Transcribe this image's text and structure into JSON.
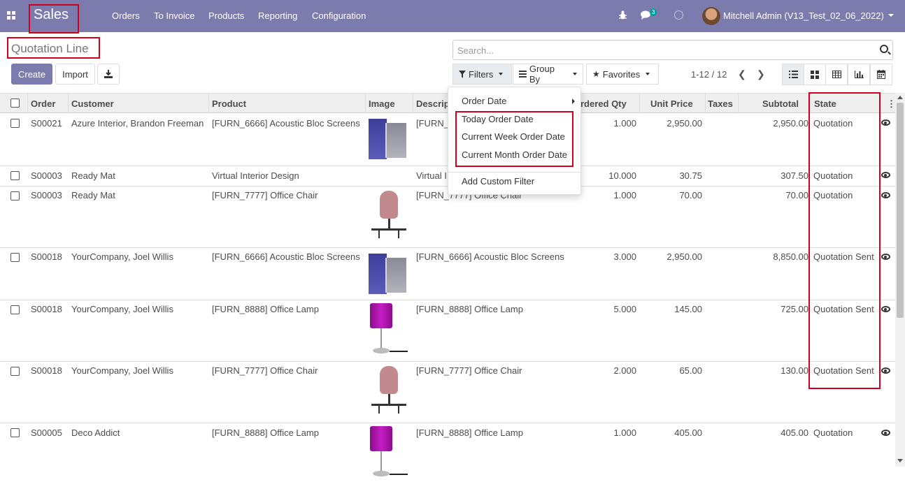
{
  "topbar": {
    "brand": "Sales",
    "menu": [
      "Orders",
      "To Invoice",
      "Products",
      "Reporting",
      "Configuration"
    ],
    "messages_count": "3",
    "user": "Mitchell Admin (V13_Test_02_06_2022)"
  },
  "page": {
    "title": "Quotation Line",
    "search_placeholder": "Search..."
  },
  "buttons": {
    "create": "Create",
    "import": "Import"
  },
  "search_panel": {
    "filters": "Filters",
    "group_by": "Group By",
    "favorites": "Favorites"
  },
  "pager": {
    "value": "1-12 / 12"
  },
  "filters_dropdown": {
    "order_date": "Order Date",
    "today": "Today Order Date",
    "current_week": "Current Week Order Date",
    "current_month": "Current Month Order Date",
    "custom": "Add Custom Filter"
  },
  "table": {
    "headers": {
      "order": "Order",
      "customer": "Customer",
      "product": "Product",
      "image": "Image",
      "description": "Descrip",
      "ordered_qty": "rdered Qty",
      "unit_price": "Unit Price",
      "taxes": "Taxes",
      "subtotal": "Subtotal",
      "state": "State"
    },
    "rows": [
      {
        "order": "S00021",
        "customer": "Azure Interior, Brandon Freeman",
        "product": "[FURN_6666] Acoustic Bloc Screens",
        "image": "screens",
        "description": "[FURN_",
        "qty": "1.000",
        "price": "2,950.00",
        "subtotal": "2,950.00",
        "state": "Quotation"
      },
      {
        "order": "S00003",
        "customer": "Ready Mat",
        "product": "Virtual Interior Design",
        "image": "",
        "description": "Virtual I",
        "qty": "10.000",
        "price": "30.75",
        "subtotal": "307.50",
        "state": "Quotation"
      },
      {
        "order": "S00003",
        "customer": "Ready Mat",
        "product": "[FURN_7777] Office Chair",
        "image": "chair",
        "description": "[FURN_7777] Office Chair",
        "qty": "1.000",
        "price": "70.00",
        "subtotal": "70.00",
        "state": "Quotation"
      },
      {
        "order": "S00018",
        "customer": "YourCompany, Joel Willis",
        "product": "[FURN_6666] Acoustic Bloc Screens",
        "image": "screens",
        "description": "[FURN_6666] Acoustic Bloc Screens",
        "qty": "3.000",
        "price": "2,950.00",
        "subtotal": "8,850.00",
        "state": "Quotation Sent"
      },
      {
        "order": "S00018",
        "customer": "YourCompany, Joel Willis",
        "product": "[FURN_8888] Office Lamp",
        "image": "lamp",
        "description": "[FURN_8888] Office Lamp",
        "qty": "5.000",
        "price": "145.00",
        "subtotal": "725.00",
        "state": "Quotation Sent"
      },
      {
        "order": "S00018",
        "customer": "YourCompany, Joel Willis",
        "product": "[FURN_7777] Office Chair",
        "image": "chair",
        "description": "[FURN_7777] Office Chair",
        "qty": "2.000",
        "price": "65.00",
        "subtotal": "130.00",
        "state": "Quotation Sent"
      },
      {
        "order": "S00005",
        "customer": "Deco Addict",
        "product": "[FURN_8888] Office Lamp",
        "image": "lamp",
        "description": "[FURN_8888] Office Lamp",
        "qty": "1.000",
        "price": "405.00",
        "subtotal": "405.00",
        "state": "Quotation"
      }
    ]
  }
}
